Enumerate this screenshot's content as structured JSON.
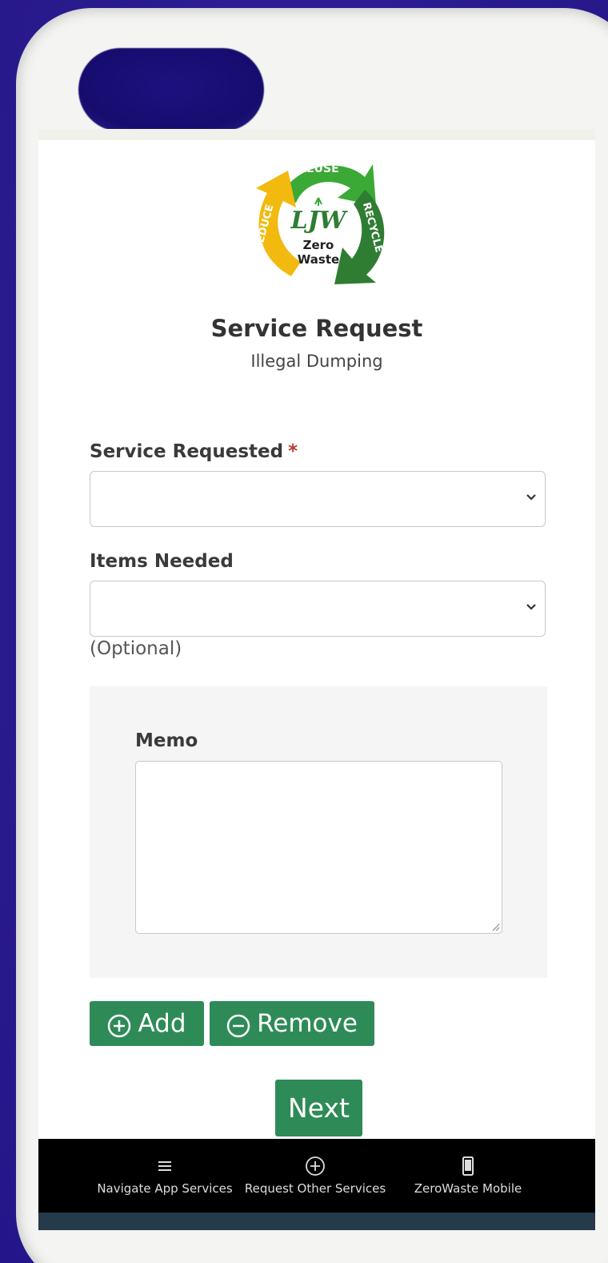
{
  "header": {
    "logo": {
      "reuse": "REUSE",
      "reduce": "REDUCE",
      "recycle": "RECYCLE",
      "monogram": "LJW",
      "line1": "Zero",
      "line2": "Waste"
    },
    "title": "Service Request",
    "subtitle": "Illegal Dumping"
  },
  "form": {
    "service_requested": {
      "label": "Service Requested",
      "required_mark": "*",
      "value": ""
    },
    "items_needed": {
      "label": "Items Needed",
      "value": "",
      "helper": "(Optional)"
    },
    "memo": {
      "label": "Memo",
      "value": ""
    },
    "add_label": "Add",
    "remove_label": "Remove",
    "next_label": "Next"
  },
  "footer_nav": {
    "items": [
      {
        "label": "Navigate App Services",
        "icon": "menu-icon"
      },
      {
        "label": "Request Other Services",
        "icon": "plus-circle-icon"
      },
      {
        "label": "ZeroWaste Mobile",
        "icon": "phone-icon"
      }
    ]
  },
  "colors": {
    "accent": "#2e8b57",
    "background": "#2b1b8f",
    "footer": "#000000",
    "required": "#c0392b"
  }
}
